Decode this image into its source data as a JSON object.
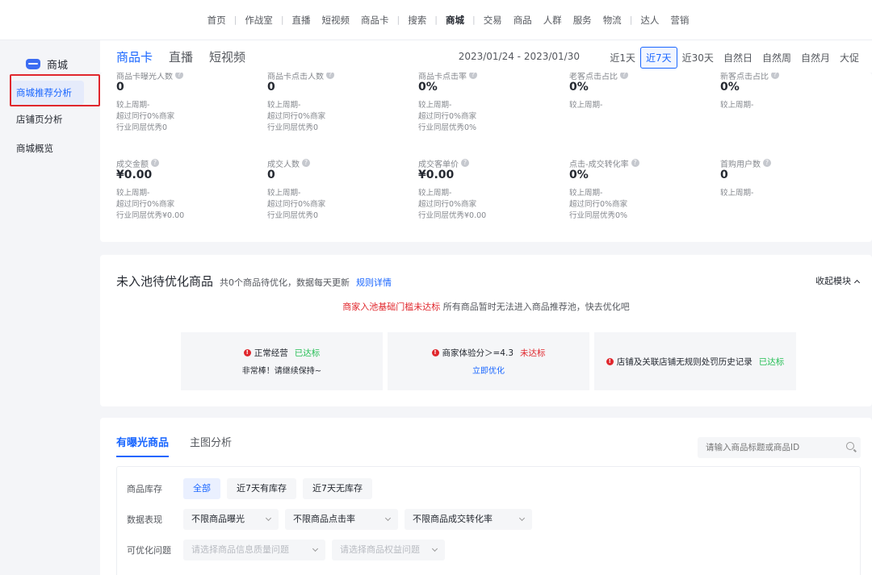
{
  "topnav": [
    "首页",
    "作战室",
    "直播",
    "短视频",
    "商品卡",
    "搜索",
    "商城",
    "交易",
    "商品",
    "人群",
    "服务",
    "物流",
    "达人",
    "营销"
  ],
  "topnav_separators_after": [
    0,
    1,
    4,
    5,
    6,
    11
  ],
  "topnav_active": "商城",
  "sidebar": {
    "title": "商城",
    "items": [
      "商城推荐分析",
      "店铺页分析",
      "商城概览"
    ]
  },
  "header": {
    "tabs": [
      "商品卡",
      "直播",
      "短视频"
    ],
    "date_range": "2023/01/24 - 2023/01/30",
    "periods": [
      "近1天",
      "近7天",
      "近30天",
      "自然日",
      "自然周",
      "自然月",
      "大促"
    ],
    "active_period": "近7天"
  },
  "metrics_row1": [
    {
      "label": "商品卡曝光人数",
      "value": "0",
      "sub": [
        "较上周期-",
        "超过同行0%商家",
        "行业同层优秀0"
      ]
    },
    {
      "label": "商品卡点击人数",
      "value": "0",
      "sub": [
        "较上周期-",
        "超过同行0%商家",
        "行业同层优秀0"
      ]
    },
    {
      "label": "商品卡点击率",
      "value": "0%",
      "sub": [
        "较上周期-",
        "超过同行0%商家",
        "行业同层优秀0%"
      ]
    },
    {
      "label": "老客点击占比",
      "value": "0%",
      "sub": [
        "较上周期-"
      ]
    },
    {
      "label": "新客点击占比",
      "value": "0%",
      "sub": [
        "较上周期-"
      ]
    }
  ],
  "metrics_row2": [
    {
      "label": "成交金额",
      "value": "¥0.00",
      "sub": [
        "较上周期-",
        "超过同行0%商家",
        "行业同层优秀¥0.00"
      ]
    },
    {
      "label": "成交人数",
      "value": "0",
      "sub": [
        "较上周期-",
        "超过同行0%商家",
        "行业同层优秀0"
      ]
    },
    {
      "label": "成交客单价",
      "value": "¥0.00",
      "sub": [
        "较上周期-",
        "超过同行0%商家",
        "行业同层优秀¥0.00"
      ]
    },
    {
      "label": "点击-成交转化率",
      "value": "0%",
      "sub": [
        "较上周期-",
        "超过同行0%商家",
        "行业同层优秀0%"
      ]
    },
    {
      "label": "首购用户数",
      "value": "0",
      "sub": [
        "较上周期-"
      ]
    }
  ],
  "pool": {
    "title": "未入池待优化商品",
    "desc": "共0个商品待优化，数据每天更新",
    "rule_link": "规则详情",
    "collapse": "收起模块",
    "warn_red": "商家入池基础门槛未达标",
    "warn_rest": " 所有商品暂时无法进入商品推荐池，快去优化吧",
    "cards": [
      {
        "title": "正常经营",
        "status": "已达标",
        "status_type": "ok",
        "sub": "非常棒！请继续保持~"
      },
      {
        "title": "商家体验分＞=4.3",
        "status": "未达标",
        "status_type": "bad",
        "link": "立即优化"
      },
      {
        "title": "店铺及关联店铺无规则处罚历史记录",
        "status": "已达标",
        "status_type": "ok"
      }
    ]
  },
  "products": {
    "tabs": [
      "有曝光商品",
      "主图分析"
    ],
    "search_placeholder": "请输入商品标题或商品ID",
    "stock_label": "商品库存",
    "stock_options": [
      "全部",
      "近7天有库存",
      "近7天无库存"
    ],
    "perf_label": "数据表现",
    "perf_selects": [
      "不限商品曝光",
      "不限商品点击率",
      "不限商品成交转化率"
    ],
    "issue_label": "可优化问题",
    "issue_selects": [
      "请选择商品信息质量问题",
      "请选择商品权益问题"
    ]
  }
}
